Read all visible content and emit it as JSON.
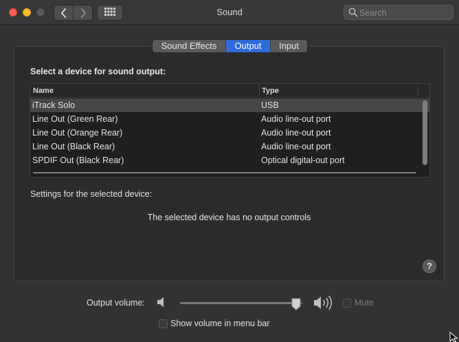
{
  "window": {
    "title": "Sound"
  },
  "toolbar": {
    "back_icon": "chevron-left-icon",
    "forward_icon": "chevron-right-icon",
    "show_all_icon": "grid-icon"
  },
  "search": {
    "placeholder": "Search",
    "value": ""
  },
  "tabs": [
    {
      "label": "Sound Effects",
      "active": false
    },
    {
      "label": "Output",
      "active": true
    },
    {
      "label": "Input",
      "active": false
    }
  ],
  "output": {
    "heading": "Select a device for sound output:",
    "columns": [
      "Name",
      "Type"
    ],
    "devices": [
      {
        "name": "iTrack Solo",
        "type": "USB",
        "selected": true
      },
      {
        "name": "Line Out (Green Rear)",
        "type": "Audio line-out port",
        "selected": false
      },
      {
        "name": "Line Out (Orange Rear)",
        "type": "Audio line-out port",
        "selected": false
      },
      {
        "name": "Line Out (Black Rear)",
        "type": "Audio line-out port",
        "selected": false
      },
      {
        "name": "SPDIF Out (Black Rear)",
        "type": "Optical digital-out port",
        "selected": false
      }
    ],
    "settings_label": "Settings for the selected device:",
    "no_controls_message": "The selected device has no output controls",
    "help_label": "?"
  },
  "volume": {
    "label": "Output volume:",
    "level": 0.95,
    "mute_label": "Mute",
    "mute_checked": false,
    "mute_enabled": false,
    "show_in_menubar_label": "Show volume in menu bar",
    "show_in_menubar_checked": false
  },
  "colors": {
    "accent": "#2f6ad8",
    "close": "#fe5f57",
    "minimize": "#febc2e",
    "zoom_disabled": "#5c5c5c"
  }
}
